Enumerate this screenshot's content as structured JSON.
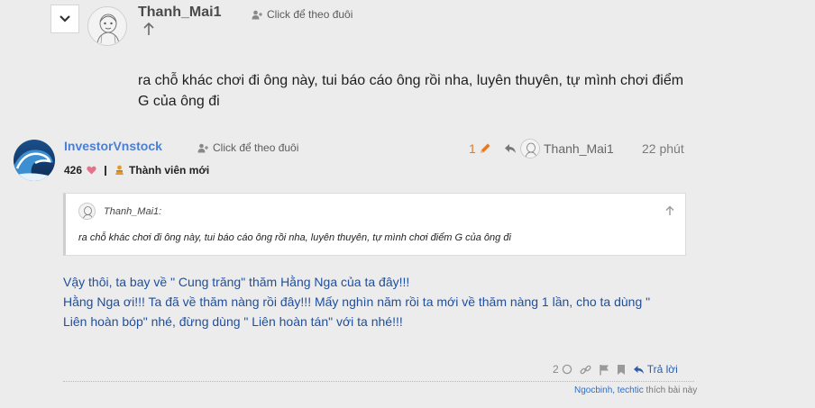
{
  "post1": {
    "username": "Thanh_Mai1",
    "follow_label": "Click để theo đuôi",
    "body_lines": [
      "ra chỗ khác chơi đi ông này, tui báo cáo ông rồi nha, luyên thuyên, tự mình chơi điểm",
      "G của ông đi"
    ]
  },
  "post2": {
    "username": "InvestorVnstock",
    "follow_label": "Click để theo đuôi",
    "likes": "426",
    "rank": "Thành viên mới",
    "edit_count": "1",
    "reply_to_user": "Thanh_Mai1",
    "time": "22 phút",
    "quote": {
      "user": "Thanh_Mai1:",
      "text": "ra chỗ khác chơi đi ông này, tui báo cáo ông rồi nha, luyên thuyên, tự mình chơi điểm G của ông đi"
    },
    "body_lines": [
      "Vậy thôi, ta bay về \" Cung trăng\" thăm Hằng Nga của ta đây!!!",
      "Hằng Nga ơi!!! Ta đã về thăm nàng rồi đây!!! Mấy nghìn năm rồi ta mới về thăm nàng 1 lần, cho ta dùng \"",
      "Liên hoàn bóp\" nhé, đừng dùng \" Liên hoàn tán\" với ta nhé!!!"
    ],
    "actions": {
      "like_count": "2",
      "reply_label": "Trả lời"
    },
    "liked_by": {
      "names": "Ngocbinh, techtic",
      "suffix": " thích bài này"
    }
  },
  "colors": {
    "background": "#ececec",
    "username_link": "#4a7fd6",
    "body_text_blue": "#1e4fa0",
    "edit_orange": "#e87722",
    "heart": "#e8708a"
  }
}
